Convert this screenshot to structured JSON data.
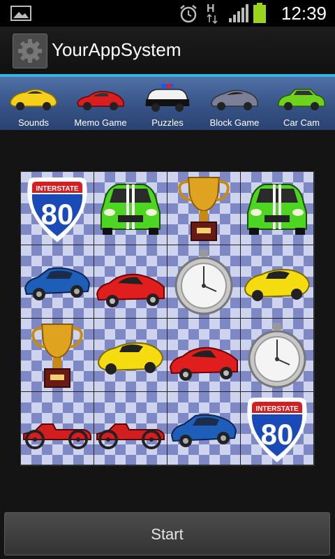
{
  "status_bar": {
    "time": "12:39",
    "network": "H"
  },
  "app": {
    "title": "YourAppSystem"
  },
  "tabs": [
    {
      "label": "Sounds",
      "icon": "yellow-sports-car-icon"
    },
    {
      "label": "Memo Game",
      "icon": "red-sports-car-icon"
    },
    {
      "label": "Puzzles",
      "icon": "police-car-icon"
    },
    {
      "label": "Block Game",
      "icon": "grey-sports-car-icon"
    },
    {
      "label": "Car Cam",
      "icon": "green-car-icon"
    }
  ],
  "grid": {
    "cards": [
      "interstate-80-sign",
      "green-car",
      "gold-trophy",
      "green-car",
      "blue-car",
      "red-car",
      "stopwatch",
      "yellow-car",
      "gold-trophy",
      "yellow-car",
      "red-car",
      "stopwatch",
      "red-vintage-car",
      "red-vintage-car",
      "blue-car",
      "interstate-80-sign"
    ],
    "sign_text": "INTERSTATE",
    "sign_number": "80"
  },
  "start_button": {
    "label": "Start"
  },
  "colors": {
    "accent": "#34b4e3",
    "tab_bar": "#3a5a94",
    "battery": "#9ad21c"
  }
}
